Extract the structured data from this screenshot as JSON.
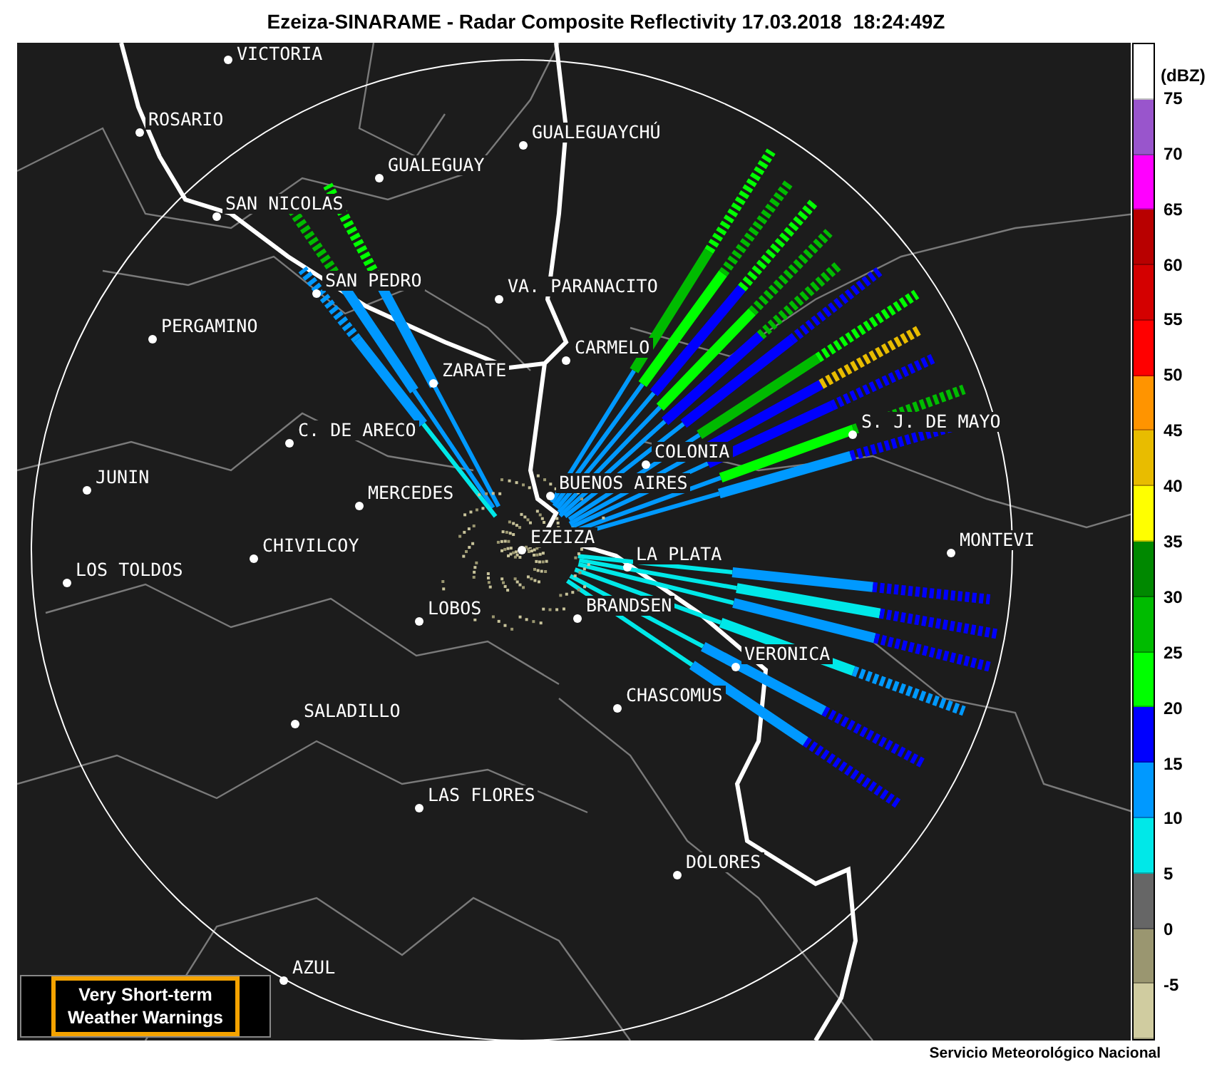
{
  "title": "Ezeiza-SINARAME - Radar Composite Reflectivity 17.03.2018  18:24:49Z",
  "cities": [
    {
      "name": "VICTORIA"
    },
    {
      "name": "ROSARIO"
    },
    {
      "name": "GUALEGUAYCHÚ"
    },
    {
      "name": "GUALEGUAY"
    },
    {
      "name": "SAN NICOLAS"
    },
    {
      "name": "SAN PEDRO"
    },
    {
      "name": "VA. PARANACITO"
    },
    {
      "name": "PERGAMINO"
    },
    {
      "name": "CARMELO"
    },
    {
      "name": "ZARATE"
    },
    {
      "name": "S. J. DE MAYO"
    },
    {
      "name": "C. DE ARECO"
    },
    {
      "name": "COLONIA"
    },
    {
      "name": "JUNIN"
    },
    {
      "name": "BUENOS AIRES"
    },
    {
      "name": "MERCEDES"
    },
    {
      "name": "EZEIZA"
    },
    {
      "name": "CHIVILCOY"
    },
    {
      "name": "MONTEVI"
    },
    {
      "name": "LA PLATA"
    },
    {
      "name": "LOS TOLDOS"
    },
    {
      "name": "LOBOS"
    },
    {
      "name": "BRANDSEN"
    },
    {
      "name": "VERONICA"
    },
    {
      "name": "CHASCOMUS"
    },
    {
      "name": "SALADILLO"
    },
    {
      "name": "LAS FLORES"
    },
    {
      "name": "DOLORES"
    },
    {
      "name": "AZUL"
    }
  ],
  "warning_badge": {
    "line_1": "Very Short-term",
    "line_2": "Weather Warnings"
  },
  "legend": {
    "unit": "(dBZ)",
    "scale": [
      {
        "color": "#ffffff",
        "label": "75"
      },
      {
        "color": "#9955cc",
        "label": "70"
      },
      {
        "color": "#ff00ff",
        "label": "65"
      },
      {
        "color": "#b80000",
        "label": "60"
      },
      {
        "color": "#d40000",
        "label": "55"
      },
      {
        "color": "#ff0000",
        "label": "50"
      },
      {
        "color": "#ff9400",
        "label": "45"
      },
      {
        "color": "#e8bc00",
        "label": "40"
      },
      {
        "color": "#ffff00",
        "label": "35"
      },
      {
        "color": "#008800",
        "label": "30"
      },
      {
        "color": "#00bb00",
        "label": "25"
      },
      {
        "color": "#00ff00",
        "label": "20"
      },
      {
        "color": "#0000ff",
        "label": "15"
      },
      {
        "color": "#0099ff",
        "label": "10"
      },
      {
        "color": "#00e8e8",
        "label": "5"
      },
      {
        "color": "#666666",
        "label": "0"
      },
      {
        "color": "#9a9670",
        "label": "-5"
      },
      {
        "color": "#d0cca0"
      }
    ]
  },
  "credit": "Servicio Meteorológico Nacional"
}
